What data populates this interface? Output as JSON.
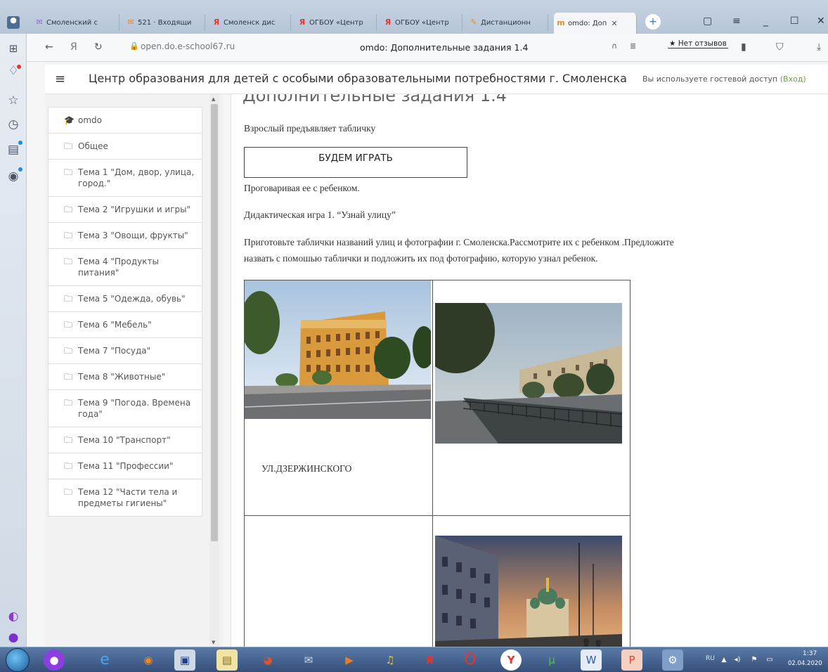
{
  "browser": {
    "tabs": [
      {
        "label": "Смоленский с",
        "icon": "mail-icon"
      },
      {
        "label": "521 · Входящи",
        "icon": "mail-icon"
      },
      {
        "label": "Смоленск дис",
        "icon": "yandex-icon"
      },
      {
        "label": "ОГБОУ «Центр",
        "icon": "yandex-icon"
      },
      {
        "label": "ОГБОУ «Центр",
        "icon": "yandex-icon"
      },
      {
        "label": "Дистанционн",
        "icon": "moodle-icon"
      },
      {
        "label": "omdo: Доп",
        "icon": "moodle-icon",
        "active": true
      }
    ],
    "url": "open.do.e-school67.ru",
    "page_title": "omdo: Дополнительные задания 1.4",
    "reviews_label": "★ Нет отзывов"
  },
  "header": {
    "site_title": "Центр образования для детей с особыми образовательными потребностями г. Смоленска",
    "guest_text": "Вы используете гостевой доступ",
    "login_label": "(Вход)"
  },
  "drawer": {
    "items": [
      {
        "label": "omdo",
        "icon": "mortarboard-icon"
      },
      {
        "label": "Общее",
        "icon": "folder-icon"
      },
      {
        "label": "Тема 1 \"Дом, двор, улица, город.\"",
        "icon": "folder-icon"
      },
      {
        "label": "Тема 2 \"Игрушки и игры\"",
        "icon": "folder-icon"
      },
      {
        "label": "Тема 3 \"Овощи, фрукты\"",
        "icon": "folder-icon"
      },
      {
        "label": "Тема 4 \"Продукты питания\"",
        "icon": "folder-icon"
      },
      {
        "label": "Тема 5 \"Одежда, обувь\"",
        "icon": "folder-icon"
      },
      {
        "label": "Тема 6 \"Мебель\"",
        "icon": "folder-icon"
      },
      {
        "label": "Тема 7 \"Посуда\"",
        "icon": "folder-icon"
      },
      {
        "label": "Тема 8 \"Животные\"",
        "icon": "folder-icon"
      },
      {
        "label": "Тема 9 \"Погода. Времена года\"",
        "icon": "folder-icon"
      },
      {
        "label": "Тема 10 \"Транспорт\"",
        "icon": "folder-icon"
      },
      {
        "label": "Тема 11 \"Профессии\"",
        "icon": "folder-icon"
      },
      {
        "label": "Тема 12 \"Части тела и предметы гигиены\"",
        "icon": "folder-icon"
      }
    ]
  },
  "content": {
    "heading": "Дополнительные задания 1.4",
    "p1": "Взрослый предъявляет табличку",
    "sign_text": "БУДЕМ ИГРАТЬ",
    "p2": "Проговаривая ее с ребенком.",
    "p3": "Дидактическая игра 1. “Узнай улицу”",
    "p4_line1": "Приготовьте таблички названий улиц и фотографии г. Смоленска.Рассмотрите их с ребенком .Предложите",
    "p4_line2": "назвать с помошью таблички и подложить их под фотографию, которую узнал ребенок.",
    "street_label": "УЛ.ДЗЕРЖИНСКОГО"
  },
  "taskbar": {
    "lang": "RU",
    "time": "1:37",
    "date": "02.04.2020"
  }
}
